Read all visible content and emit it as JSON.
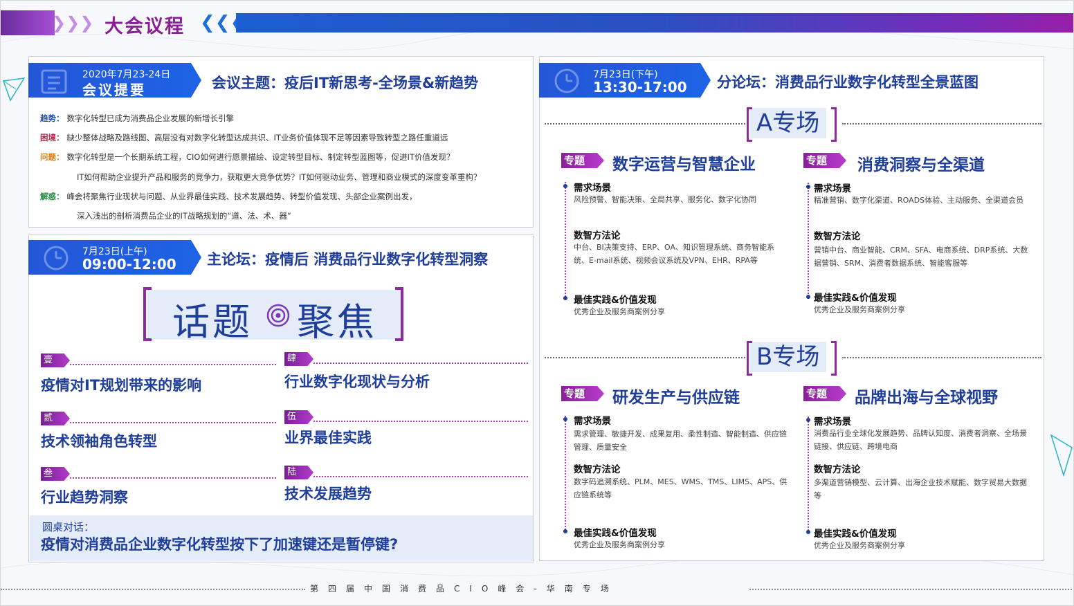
{
  "header": {
    "title": "大会议程"
  },
  "summary": {
    "date": "2020年7月23-24日",
    "label": "会议提要",
    "theme": "会议主题：疫后IT新思考-全场景&新趋势",
    "trend_key": "趋势：",
    "trend_text": "数字化转型已成为消费品企业发展的新增长引擎",
    "block_key": "困境：",
    "block_text": "缺少整体战略及路线图、高层没有对数字化转型达成共识、IT业务价值体现不足等因素导致转型之路任重道远",
    "question_key": "问题：",
    "question_text": "数字化转型是一个长期系统工程，CIO如何进行愿景描绘、设定转型目标、制定转型蓝图等，促进IT价值发现？",
    "question_text2": "IT如何帮助企业提升产品和服务的竞争力，获取更大竞争优势？IT如何驱动业务、管理和商业模式的深度变革重构？",
    "solution_key": "解惑：",
    "solution_text": "峰会将聚焦行业现状与问题、从业界最佳实践、技术发展趋势、转型价值发现、头部企业案例出发，",
    "solution_text2": "深入浅出的剖析消费品企业的IT战略规划的“道、法、术、器”"
  },
  "main_forum": {
    "date": "7月23日(上午)",
    "time": "09:00-12:00",
    "title": "主论坛：疫情后 消费品行业数字化转型洞察",
    "focus_left": "话题",
    "focus_right": "聚焦",
    "topics": [
      {
        "tag": "壹",
        "title": "疫情对IT规划带来的影响"
      },
      {
        "tag": "贰",
        "title": "技术领袖角色转型"
      },
      {
        "tag": "叁",
        "title": "行业趋势洞察"
      },
      {
        "tag": "肆",
        "title": "行业数字化现状与分析"
      },
      {
        "tag": "伍",
        "title": "业界最佳实践"
      },
      {
        "tag": "陆",
        "title": "技术发展趋势"
      }
    ],
    "roundtable_label": "圆桌对话：",
    "roundtable_question": "疫情对消费品企业数字化转型按下了加速键还是暂停键?"
  },
  "sub_forum": {
    "date": "7月23日(下午)",
    "time": "13:30-17:00",
    "title": "分论坛：消费品行业数字化转型全景蓝图",
    "track_a": "A专场",
    "track_b": "B专场",
    "tag_label": "专题",
    "sessions": [
      {
        "title": "数字运营与智慧企业",
        "h1": "需求场景",
        "b1": "风险预警、智能决策、全局共享、服务化、数字化协同",
        "h2": "数智方法论",
        "b2": "中台、BI决策支持、ERP、OA、知识管理系统、商务智能系统、E-mail系统、视频会议系统及VPN、EHR、RPA等",
        "h3": "最佳实践&价值发现",
        "b3": "优秀企业及服务商案例分享"
      },
      {
        "title": "消费洞察与全渠道",
        "h1": "需求场景",
        "b1": "精准营销、数字化渠道、ROADS体验、主动服务、全渠道会员",
        "h2": "数智方法论",
        "b2": "营销中台、商业智能、CRM、SFA、电商系统、DRP系统、大数据营销、SRM、消费者数据系统、智能客服等",
        "h3": "最佳实践&价值发现",
        "b3": "优秀企业及服务商案例分享"
      },
      {
        "title": "研发生产与供应链",
        "h1": "需求场景",
        "b1": "需求管理、敏捷开发、成果复用、柔性制造、智能制造、供应链管理、质量安全",
        "h2": "数智方法论",
        "b2": "数字码追溯系统、PLM、MES、WMS、TMS、LIMS、APS、供应链系统等",
        "h3": "最佳实践&价值发现",
        "b3": "优秀企业及服务商案例分享"
      },
      {
        "title": "品牌出海与全球视野",
        "h1": "需求场景",
        "b1": "消费品行业全球化发展趋势、品牌认知度、消费者洞察、全场景链接、供应链、跨境电商",
        "h2": "数智方法论",
        "b2": "多渠道营销模型、云计算、出海企业技术赋能、数字贸易大数据等",
        "h3": "最佳实践&价值发现",
        "b3": "优秀企业及服务商案例分享"
      }
    ]
  },
  "footer": {
    "text": "第四届中国消费品CIO峰会-华南专场"
  },
  "colors": {
    "primary_blue": "#1e3e9a",
    "ribbon_blue": "#2456d8",
    "accent_purple": "#8e2aa0"
  }
}
